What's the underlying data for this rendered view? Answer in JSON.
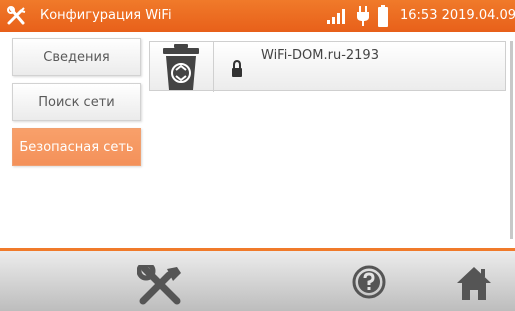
{
  "header": {
    "title": "Конфигурация WiFi",
    "time": "16:53",
    "date": "2019.04.09",
    "accent_color": "#f07a2a"
  },
  "menu": [
    {
      "label": "Сведения",
      "active": false
    },
    {
      "label": "Поиск сети",
      "active": false
    },
    {
      "label": "Безопасная сеть",
      "active": true
    }
  ],
  "networks": [
    {
      "ssid": "WiFi-DOM.ru-2193",
      "secured": true
    }
  ],
  "icons": {
    "header_left": "tools-icon",
    "signal": "signal-icon",
    "power": "plug-icon",
    "battery": "battery-icon",
    "delete": "trash-icon",
    "lock": "lock-icon",
    "settings": "tools-icon",
    "help": "help-icon",
    "home": "home-icon"
  }
}
